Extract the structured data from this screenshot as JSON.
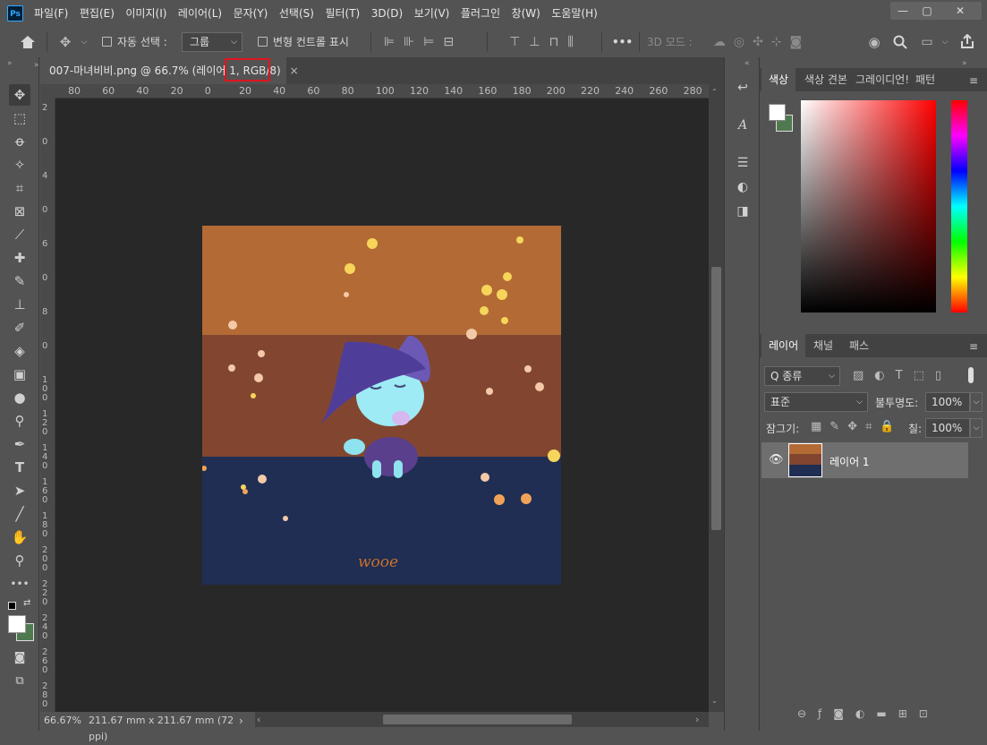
{
  "app_icon": "Ps",
  "menu": [
    "파일(F)",
    "편집(E)",
    "이미지(I)",
    "레이어(L)",
    "문자(Y)",
    "선택(S)",
    "필터(T)",
    "3D(D)",
    "보기(V)",
    "플러그인",
    "창(W)",
    "도움말(H)"
  ],
  "window_buttons": {
    "minimize": "—",
    "restore": "▢",
    "close": "✕"
  },
  "options": {
    "auto_select_label": "자동 선택 :",
    "auto_select_value": "그룹",
    "transform_label": "변형 컨트롤 표시",
    "threed_mode_label": "3D 모드 :",
    "more": "•••"
  },
  "document": {
    "tab_title": "007-마녀비비.png @ 66.7% (레이어 1, RGB/8)",
    "tab_close": "×",
    "zoom": "66.67%",
    "size_info": "211.67 mm x 211.67 mm (72 ppi)",
    "watermark": "wooe"
  },
  "ruler_h": [
    "80",
    "60",
    "40",
    "20",
    "0",
    "20",
    "40",
    "60",
    "80",
    "100",
    "120",
    "140",
    "160",
    "180",
    "200",
    "220",
    "240",
    "260",
    "280"
  ],
  "ruler_v": [
    "2",
    "0",
    "4",
    "0",
    "6",
    "0",
    "8",
    "0",
    "1\n0\n0",
    "1\n2\n0",
    "1\n4\n0",
    "1\n6\n0",
    "1\n8\n0",
    "2\n0\n0",
    "2\n2\n0",
    "2\n4\n0",
    "2\n6\n0",
    "2\n8\n0"
  ],
  "color_panel": {
    "tabs": [
      "색상",
      "색상 견본",
      "그레이디언!",
      "패턴"
    ]
  },
  "layers_panel": {
    "tabs": [
      "레이어",
      "채널",
      "패스"
    ],
    "filter_label": "Q 종류",
    "blend_mode": "표준",
    "opacity_label": "불투명도:",
    "opacity_value": "100%",
    "lock_label": "잠그기:",
    "fill_label": "칠:",
    "fill_value": "100%",
    "layer_name": "레이어 1"
  },
  "colors": {
    "accent": "#31a8ff",
    "highlight": "#e0141e",
    "canvas_top": "#b36a35",
    "canvas_mid": "#824630",
    "canvas_bot": "#1f2e52"
  }
}
